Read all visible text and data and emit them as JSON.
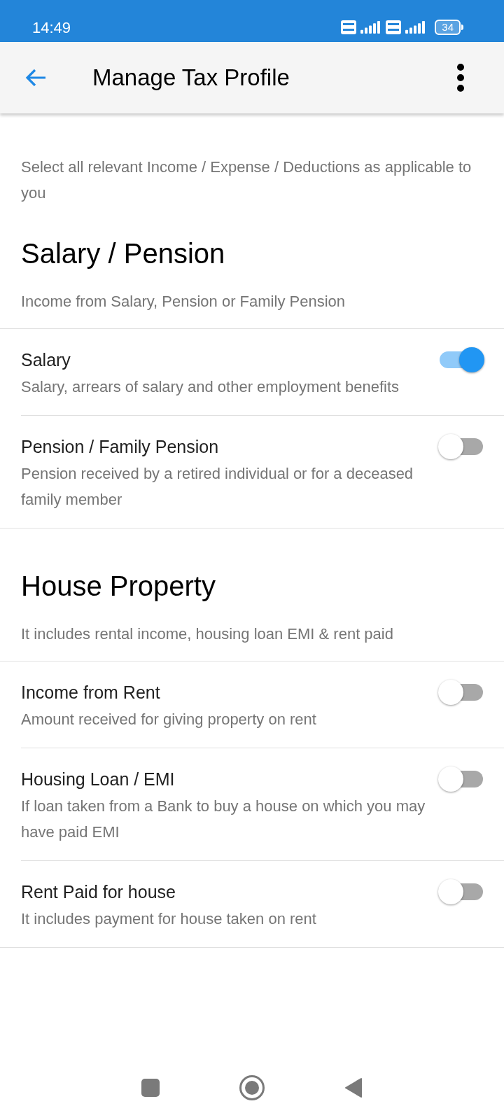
{
  "status_bar": {
    "time": "14:49",
    "battery": "34"
  },
  "app_bar": {
    "title": "Manage Tax Profile"
  },
  "intro": "Select all relevant Income / Expense / Deductions as applicable to you",
  "sections": [
    {
      "title": "Salary / Pension",
      "subtitle": "Income from Salary, Pension or Family Pension",
      "items": [
        {
          "title": "Salary",
          "description": "Salary, arrears of salary and other employment benefits",
          "on": true
        },
        {
          "title": "Pension / Family Pension",
          "description": "Pension received by a retired individual or for a deceased family member",
          "on": false
        }
      ]
    },
    {
      "title": "House Property",
      "subtitle": "It includes rental income, housing loan EMI & rent paid",
      "items": [
        {
          "title": "Income from Rent",
          "description": "Amount received for giving property on rent",
          "on": false
        },
        {
          "title": "Housing Loan / EMI",
          "description": "If loan taken from a Bank to buy a house on which you may have paid EMI",
          "on": false
        },
        {
          "title": "Rent Paid for house",
          "description": "It includes payment for house taken on rent",
          "on": false
        }
      ]
    }
  ]
}
